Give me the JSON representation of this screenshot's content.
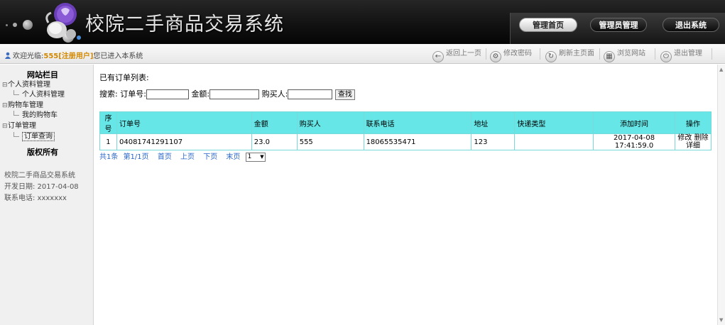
{
  "header": {
    "title": "校院二手商品交易系统",
    "nav": {
      "home": "管理首页",
      "admin": "管理员管理",
      "exit": "退出系统"
    }
  },
  "toolbar": {
    "welcome_prefix": "欢迎光临:",
    "username": "555",
    "role": "[注册用户]",
    "welcome_suffix": "您已进入本系统",
    "back": "返回上一页",
    "change_password": "修改密码",
    "refresh": "刷新主页面",
    "browse_site": "浏览网站",
    "logout": "退出管理"
  },
  "sidebar": {
    "title": "网站栏目",
    "groups": [
      {
        "label": "个人资料管理",
        "items": [
          "个人资料管理"
        ]
      },
      {
        "label": "购物车管理",
        "items": [
          "我的购物车"
        ]
      },
      {
        "label": "订单管理",
        "items": [
          "订单查询"
        ]
      }
    ],
    "copyright": "版权所有",
    "system_name": "校院二手商品交易系统",
    "dev_date": "开发日期: 2017-04-08",
    "phone": "联系电话: xxxxxxx"
  },
  "main": {
    "list_title": "已有订单列表:",
    "search": {
      "label": "搜索:",
      "order_no_label": "订单号:",
      "order_no_value": "",
      "amount_label": "金额:",
      "amount_value": "",
      "buyer_label": "购买人:",
      "buyer_value": "",
      "button": "查找"
    },
    "table": {
      "headers": [
        "序号",
        "订单号",
        "金额",
        "购买人",
        "联系电话",
        "地址",
        "快递类型",
        "添加时间",
        "操作"
      ],
      "rows": [
        {
          "index": "1",
          "order_no": "04081741291107",
          "amount": "23.0",
          "buyer": "555",
          "phone": "18065535471",
          "address": "123",
          "express": "",
          "added": "2017-04-08 17:41:59.0",
          "edit": "修改",
          "delete": "删除",
          "detail": "详细"
        }
      ]
    },
    "pager": {
      "total": "共1条",
      "page_info": "第1/1页",
      "first": "首页",
      "prev": "上页",
      "next": "下页",
      "last": "末页",
      "selected_page": "1"
    }
  },
  "colors": {
    "header_bg": "#121212",
    "table_header": "#66e6e6",
    "link": "#2a66c8",
    "username": "#d28700"
  }
}
